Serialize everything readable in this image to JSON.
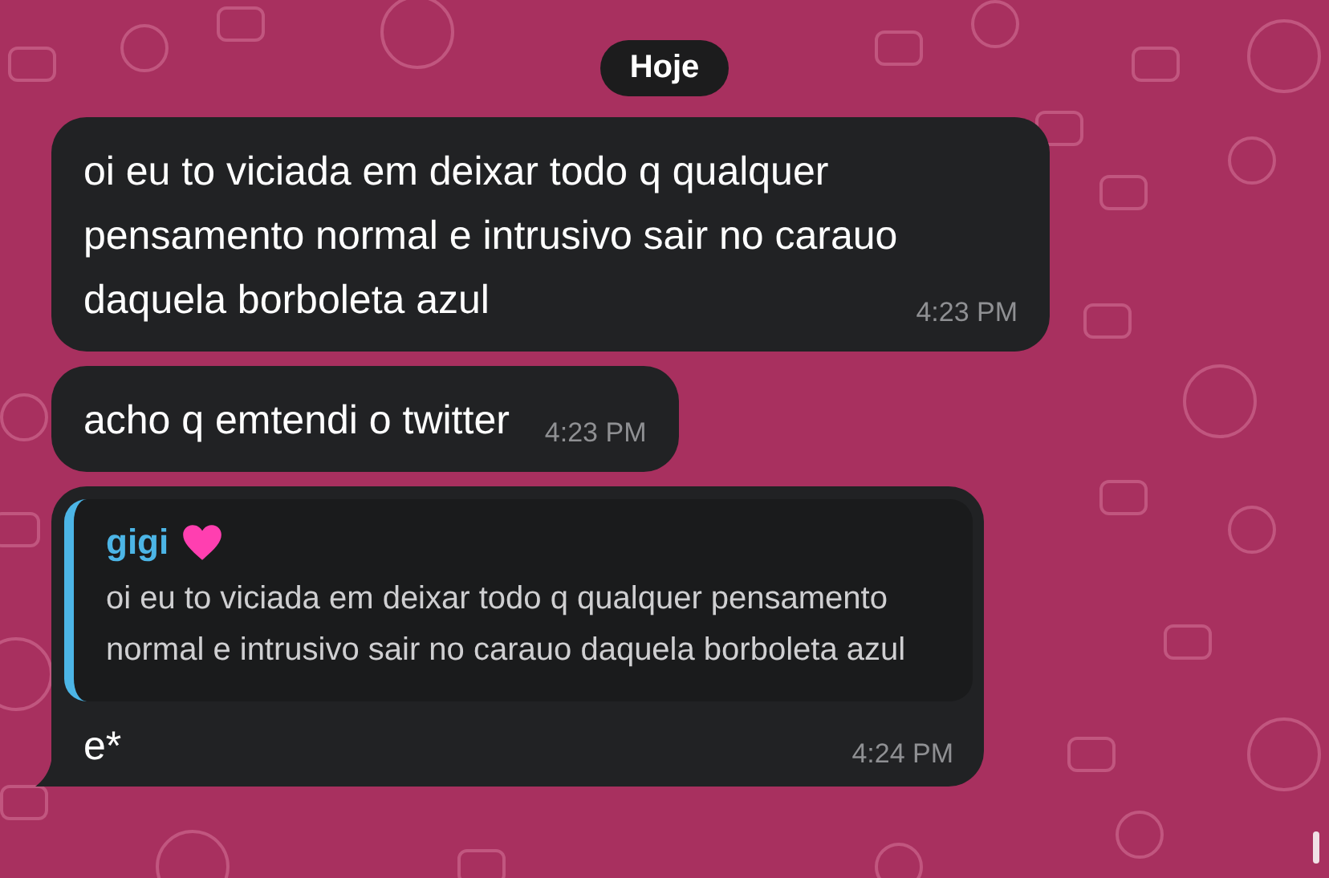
{
  "date_chip": "Hoje",
  "messages": [
    {
      "kind": "text",
      "text": "oi eu to viciada em deixar todo q qualquer pensamento normal e intrusivo sair no carauo daquela borboleta azul",
      "time": "4:23 PM",
      "tail": false
    },
    {
      "kind": "text",
      "text": "acho q emtendi o twitter",
      "time": "4:23 PM",
      "tail": false
    },
    {
      "kind": "reply",
      "quote": {
        "author": "gigi",
        "text": "oi eu to viciada em deixar todo q qualquer pensamento normal e intrusivo sair no carauo daquela borboleta azul"
      },
      "text": "e*",
      "time": "4:24 PM",
      "tail": true
    }
  ]
}
